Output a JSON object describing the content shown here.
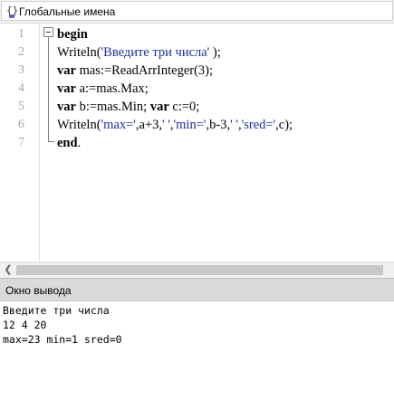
{
  "toolbar": {
    "combo_label": "Глобальные имена",
    "icon": "braces-icon"
  },
  "editor": {
    "line_numbers": [
      "1",
      "2",
      "3",
      "4",
      "5",
      "6",
      "7"
    ],
    "lines": [
      {
        "parts": [
          {
            "t": "begin",
            "c": "kw"
          }
        ]
      },
      {
        "parts": [
          {
            "t": "Writeln(",
            "c": ""
          },
          {
            "t": "'Введите три числа'",
            "c": "str"
          },
          {
            "t": " );",
            "c": ""
          }
        ]
      },
      {
        "parts": [
          {
            "t": "var",
            "c": "kw"
          },
          {
            "t": " mas:=ReadArrInteger(3);",
            "c": ""
          }
        ]
      },
      {
        "parts": [
          {
            "t": "var",
            "c": "kw"
          },
          {
            "t": " a:=mas.Max;",
            "c": ""
          }
        ]
      },
      {
        "parts": [
          {
            "t": "var",
            "c": "kw"
          },
          {
            "t": " b:=mas.Min; ",
            "c": ""
          },
          {
            "t": "var",
            "c": "kw"
          },
          {
            "t": " c:=0;",
            "c": ""
          }
        ]
      },
      {
        "parts": [
          {
            "t": "Writeln(",
            "c": ""
          },
          {
            "t": "'max='",
            "c": "str"
          },
          {
            "t": ",a+3,",
            "c": ""
          },
          {
            "t": "' '",
            "c": "str"
          },
          {
            "t": ",",
            "c": ""
          },
          {
            "t": "'min='",
            "c": "str"
          },
          {
            "t": ",b-3,",
            "c": ""
          },
          {
            "t": "' '",
            "c": "str"
          },
          {
            "t": ",",
            "c": ""
          },
          {
            "t": "'sred='",
            "c": "str"
          },
          {
            "t": ",c);",
            "c": ""
          }
        ]
      },
      {
        "parts": [
          {
            "t": "end",
            "c": "kw"
          },
          {
            "t": ".",
            "c": ""
          }
        ]
      }
    ]
  },
  "output": {
    "title": "Окно вывода",
    "lines": [
      "Введите три числа",
      "12 4 20",
      "max=23 min=1 sred=0"
    ]
  }
}
